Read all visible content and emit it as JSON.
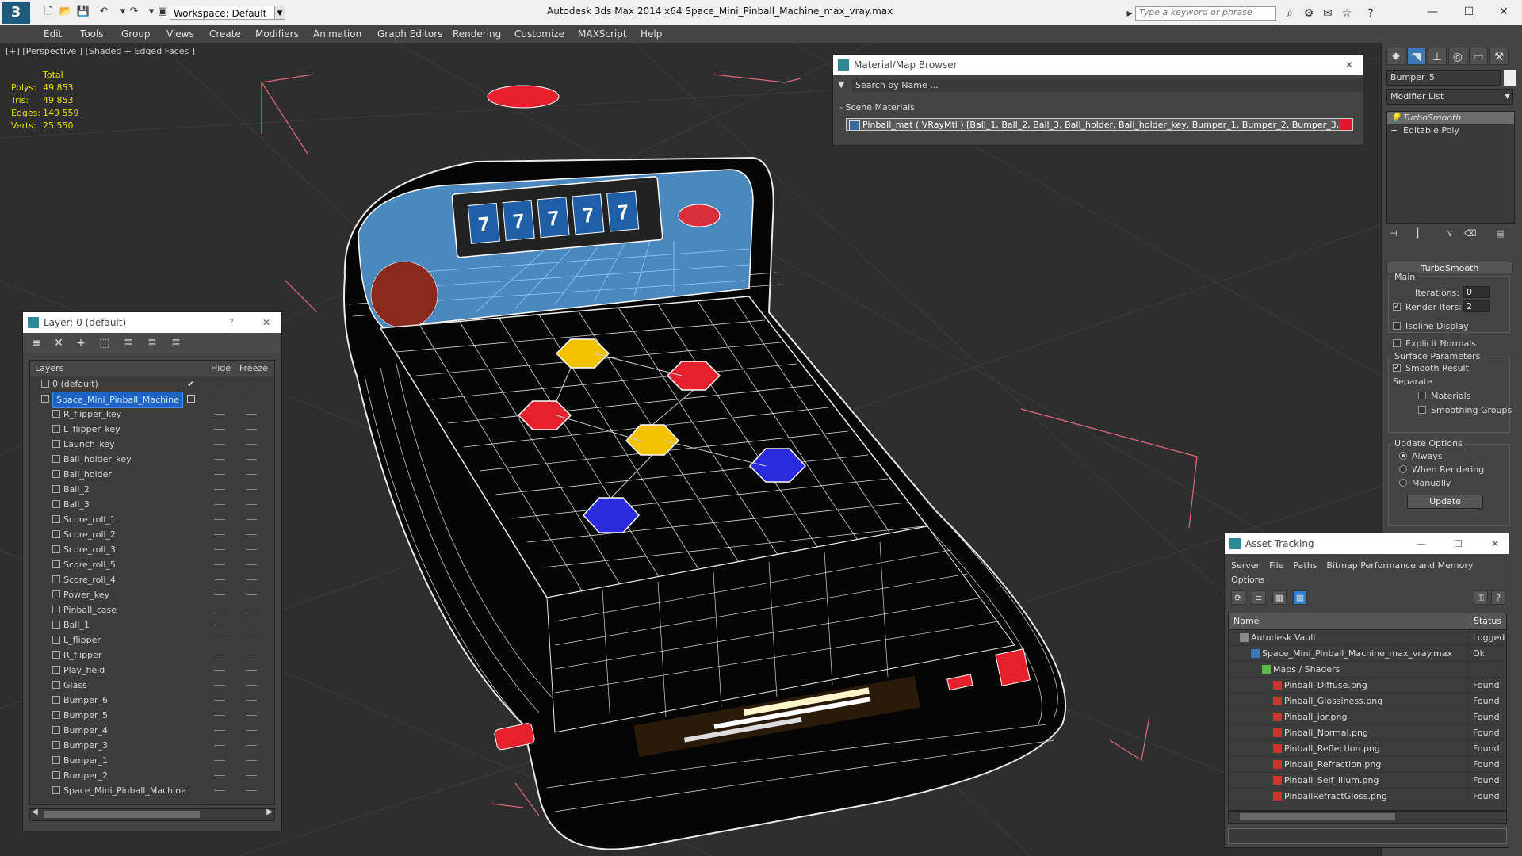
{
  "app": {
    "title": "Autodesk 3ds Max  2014 x64      Space_Mini_Pinball_Machine_max_vray.max",
    "logo": "3",
    "workspace": "Workspace: Default",
    "search_placeholder": "Type a keyword or phrase",
    "window_controls": [
      "—",
      "☐",
      "✕"
    ]
  },
  "menu": [
    "Edit",
    "Tools",
    "Group",
    "Views",
    "Create",
    "Modifiers",
    "Animation",
    "Graph Editors",
    "Rendering",
    "Customize",
    "MAXScript",
    "Help"
  ],
  "viewport": {
    "label": "[+] [Perspective ] [Shaded + Edged Faces ]",
    "stats": {
      "header": "Total",
      "rows": [
        {
          "label": "Polys:",
          "value": "49 853"
        },
        {
          "label": "Tris:",
          "value": "49 853"
        },
        {
          "label": "Edges:",
          "value": "149 559"
        },
        {
          "label": "Verts:",
          "value": "25 550"
        }
      ]
    },
    "slot_digits": [
      "7",
      "7",
      "7",
      "7",
      "7"
    ]
  },
  "layer_panel": {
    "title": "Layer: 0 (default)",
    "help": "?",
    "close": "✕",
    "columns": {
      "layers": "Layers",
      "hide": "Hide",
      "freeze": "Freeze"
    },
    "rows": [
      {
        "name": "0 (default)",
        "level": 0,
        "checked": true
      },
      {
        "name": "Space_Mini_Pinball_Machine",
        "level": 0,
        "selected": true
      },
      {
        "name": "R_flipper_key",
        "level": 1
      },
      {
        "name": "L_flipper_key",
        "level": 1
      },
      {
        "name": "Launch_key",
        "level": 1
      },
      {
        "name": "Ball_holder_key",
        "level": 1
      },
      {
        "name": "Ball_holder",
        "level": 1
      },
      {
        "name": "Ball_2",
        "level": 1
      },
      {
        "name": "Ball_3",
        "level": 1
      },
      {
        "name": "Score_roll_1",
        "level": 1
      },
      {
        "name": "Score_roll_2",
        "level": 1
      },
      {
        "name": "Score_roll_3",
        "level": 1
      },
      {
        "name": "Score_roll_5",
        "level": 1
      },
      {
        "name": "Score_roll_4",
        "level": 1
      },
      {
        "name": "Power_key",
        "level": 1
      },
      {
        "name": "Pinball_case",
        "level": 1
      },
      {
        "name": "Ball_1",
        "level": 1
      },
      {
        "name": "L_flipper",
        "level": 1
      },
      {
        "name": "R_flipper",
        "level": 1
      },
      {
        "name": "Play_field",
        "level": 1
      },
      {
        "name": "Glass",
        "level": 1
      },
      {
        "name": "Bumper_6",
        "level": 1
      },
      {
        "name": "Bumper_5",
        "level": 1
      },
      {
        "name": "Bumper_4",
        "level": 1
      },
      {
        "name": "Bumper_3",
        "level": 1
      },
      {
        "name": "Bumper_1",
        "level": 1
      },
      {
        "name": "Bumper_2",
        "level": 1
      },
      {
        "name": "Space_Mini_Pinball_Machine",
        "level": 1
      }
    ]
  },
  "material_browser": {
    "title": "Material/Map Browser",
    "close": "✕",
    "search_placeholder": "Search by Name ...",
    "section": "- Scene Materials",
    "material": "Pinball_mat  ( VRayMtl )  [Ball_1, Ball_2, Ball_3, Ball_holder, Ball_holder_key, Bumper_1, Bumper_2, Bumper_3, Bump..."
  },
  "command_panel": {
    "object_name": "Bumper_5",
    "modifier_list": "Modifier List",
    "stack": [
      "TurboSmooth",
      "Editable Poly"
    ],
    "rollout_title": "TurboSmooth",
    "main_label": "Main",
    "iterations_label": "Iterations:",
    "iterations_value": "0",
    "render_iters_label": "Render Iters:",
    "render_iters_value": "2",
    "isoline": "Isoline Display",
    "explicit_normals": "Explicit Normals",
    "surface_params": "Surface Parameters",
    "smooth_result": "Smooth Result",
    "separate": "Separate",
    "materials": "Materials",
    "smoothing_groups": "Smoothing Groups",
    "update_options": "Update Options",
    "always": "Always",
    "when_rendering": "When Rendering",
    "manually": "Manually",
    "update_button": "Update"
  },
  "asset_tracking": {
    "title": "Asset Tracking",
    "menu": [
      "Server",
      "File",
      "Paths",
      "Bitmap Performance and Memory",
      "Options"
    ],
    "columns": {
      "name": "Name",
      "status": "Status"
    },
    "rows": [
      {
        "name": "Autodesk Vault",
        "status": "Logged",
        "level": 0
      },
      {
        "name": "Space_Mini_Pinball_Machine_max_vray.max",
        "status": "Ok",
        "level": 1
      },
      {
        "name": "Maps / Shaders",
        "status": "",
        "level": 2
      },
      {
        "name": "Pinball_Diffuse.png",
        "status": "Found",
        "level": 3
      },
      {
        "name": "Pinball_Glossiness.png",
        "status": "Found",
        "level": 3
      },
      {
        "name": "Pinball_ior.png",
        "status": "Found",
        "level": 3
      },
      {
        "name": "Pinball_Normal.png",
        "status": "Found",
        "level": 3
      },
      {
        "name": "Pinball_Reflection.png",
        "status": "Found",
        "level": 3
      },
      {
        "name": "Pinball_Refraction.png",
        "status": "Found",
        "level": 3
      },
      {
        "name": "Pinball_Self_Illum.png",
        "status": "Found",
        "level": 3
      },
      {
        "name": "PinballRefractGloss.png",
        "status": "Found",
        "level": 3
      }
    ]
  },
  "colors": {
    "accent": "#1f62c5",
    "stats_text": "#e8e200",
    "bumper_yellow": "#f2c200",
    "bumper_red": "#e5212e",
    "bumper_blue": "#2a2adf",
    "selection_box": "#e06a7a"
  }
}
